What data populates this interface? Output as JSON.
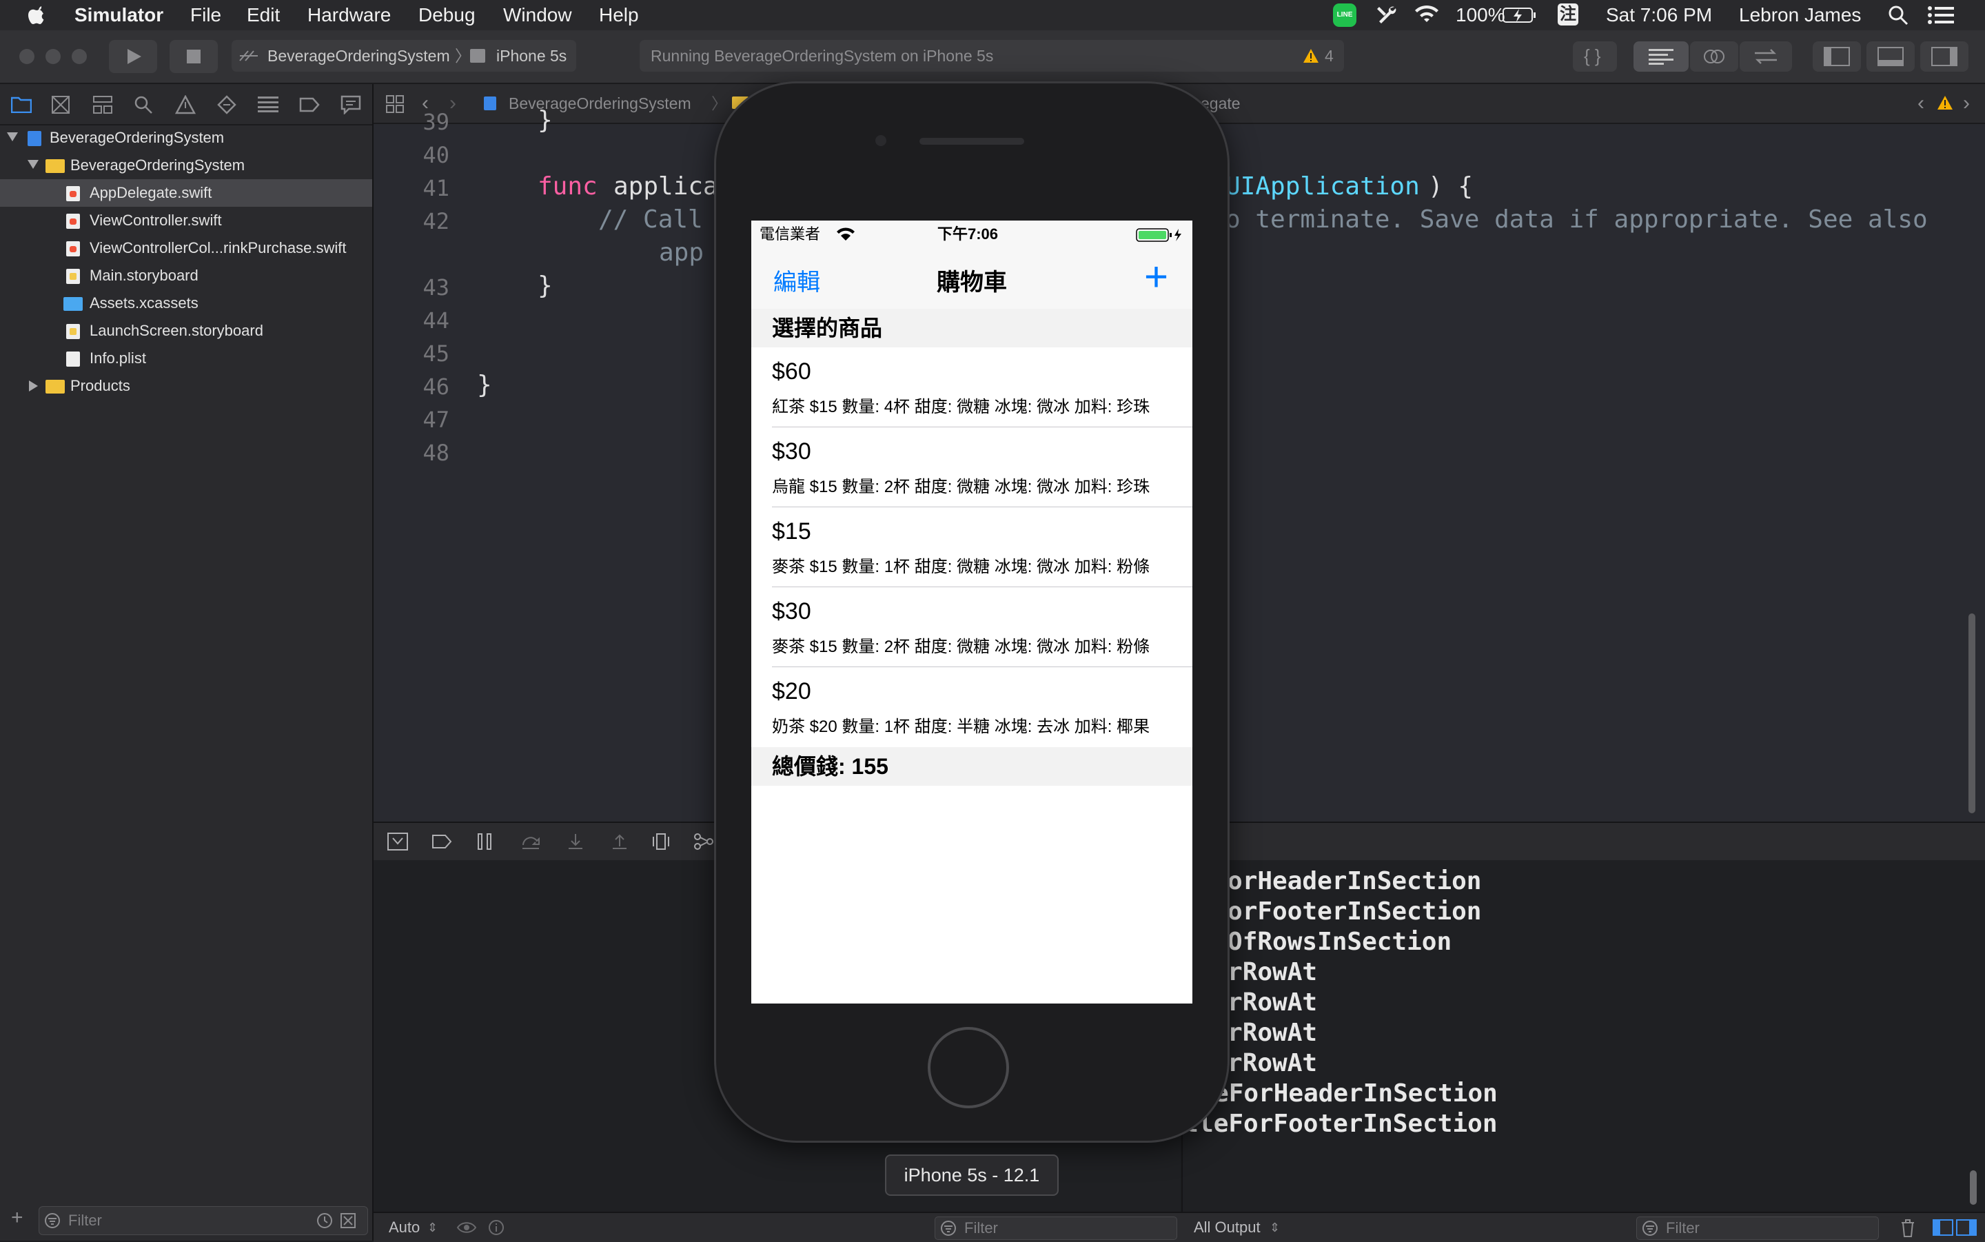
{
  "menubar": {
    "app": "Simulator",
    "items": [
      "File",
      "Edit",
      "Hardware",
      "Debug",
      "Window",
      "Help"
    ],
    "battery": "100%",
    "input_method": "注",
    "clock": "Sat 7:06 PM",
    "user": "Lebron James",
    "line_badge": "LINE"
  },
  "toolbar": {
    "scheme": "BeverageOrderingSystem",
    "device": "iPhone 5s",
    "activity": "Running BeverageOrderingSystem on iPhone 5s",
    "warning_count": "4"
  },
  "navigator": {
    "project": "BeverageOrderingSystem",
    "group": "BeverageOrderingSystem",
    "files": [
      "AppDelegate.swift",
      "ViewController.swift",
      "ViewControllerCol...rinkPurchase.swift",
      "Main.storyboard",
      "Assets.xcassets",
      "LaunchScreen.storyboard",
      "Info.plist"
    ],
    "products": "Products",
    "filter_placeholder": "Filter"
  },
  "jumpbar": {
    "crumb1": "BeverageOrderingSystem",
    "crumb_tail": "egate"
  },
  "editor": {
    "line_numbers": [
      "39",
      "40",
      "41",
      "42",
      "43",
      "44",
      "45",
      "46",
      "47",
      "48"
    ],
    "func_kw": "func",
    "func_name": "applica",
    "func_type": "UIApplication",
    "func_close": ") {",
    "comment_start": "// Call",
    "comment_end": "o terminate. Save data if appropriate. See also",
    "comment_cont": "app",
    "brace_close_inner": "}",
    "brace_close_outer": "}",
    "partial_top": "}"
  },
  "console": {
    "lines": [
      "leForHeaderInSection",
      "leForFooterInSection",
      "berOfRowsInSection",
      "lForRowAt",
      "lForRowAt",
      "lForRowAt",
      "lForRowAt",
      "itleForHeaderInSection",
      "titleForFooterInSection"
    ]
  },
  "bottombar": {
    "auto": "Auto",
    "filter1": "Filter",
    "output": "All Output",
    "filter2": "Filter"
  },
  "simulator": {
    "device_label": "iPhone 5s - 12.1",
    "status": {
      "carrier": "電信業者",
      "time": "下午7:06"
    },
    "nav": {
      "edit": "編輯",
      "title": "購物車",
      "add": "+"
    },
    "section_header": "選擇的商品",
    "items": [
      {
        "price": "$60",
        "detail": "紅茶 $15 數量: 4杯 甜度: 微糖 冰塊: 微冰 加料: 珍珠"
      },
      {
        "price": "$30",
        "detail": "烏龍 $15 數量: 2杯 甜度: 微糖 冰塊: 微冰 加料: 珍珠"
      },
      {
        "price": "$15",
        "detail": "麥茶 $15 數量: 1杯 甜度: 微糖 冰塊: 微冰 加料: 粉條"
      },
      {
        "price": "$30",
        "detail": "麥茶 $15 數量: 2杯 甜度: 微糖 冰塊: 微冰 加料: 粉條"
      },
      {
        "price": "$20",
        "detail": "奶茶 $20 數量: 1杯 甜度: 半糖 冰塊: 去冰 加料: 椰果"
      }
    ],
    "section_footer": "總價錢: 155"
  },
  "colors": {
    "ios_tint": "#007aff",
    "warning": "#f5b000",
    "swift_keyword": "#fc5fa3",
    "swift_type": "#5dd8ff"
  }
}
